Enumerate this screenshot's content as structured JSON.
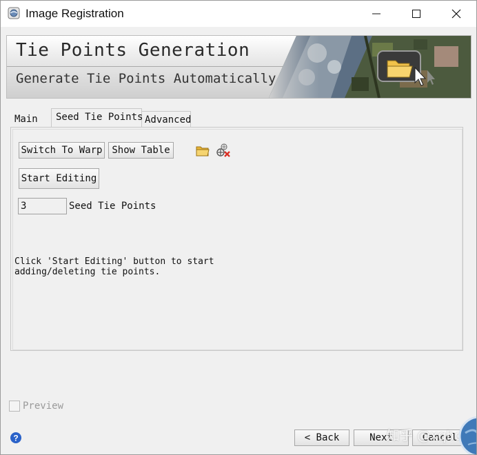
{
  "window": {
    "title": "Image Registration"
  },
  "banner": {
    "title": "Tie Points Generation",
    "subtitle": "Generate Tie Points Automatically"
  },
  "tabs": [
    {
      "label": "Main"
    },
    {
      "label": "Seed Tie Points",
      "selected": true
    },
    {
      "label": "Advanced"
    }
  ],
  "seed_panel": {
    "switch_to_warp_label": "Switch To Warp",
    "show_table_label": "Show Table",
    "start_editing_label": "Start Editing",
    "seed_count_value": "3",
    "seed_count_label": "Seed Tie Points",
    "help_text": "Click 'Start Editing' button to start\nadding/deleting tie points."
  },
  "footer": {
    "preview_label": "Preview",
    "preview_checked": false,
    "back_label": "< Back",
    "next_label": "Next",
    "cancel_label": "Cancel"
  },
  "watermark": "知乎 @xqhd",
  "icons": {
    "app": "envi-app-icon",
    "open": "folder-open-icon",
    "delete": "delete-tie-points-icon",
    "help": "help-icon"
  },
  "colors": {
    "help_blue": "#2a62c9",
    "folder_yellow": "#f2c44d",
    "delete_red": "#d93025"
  }
}
